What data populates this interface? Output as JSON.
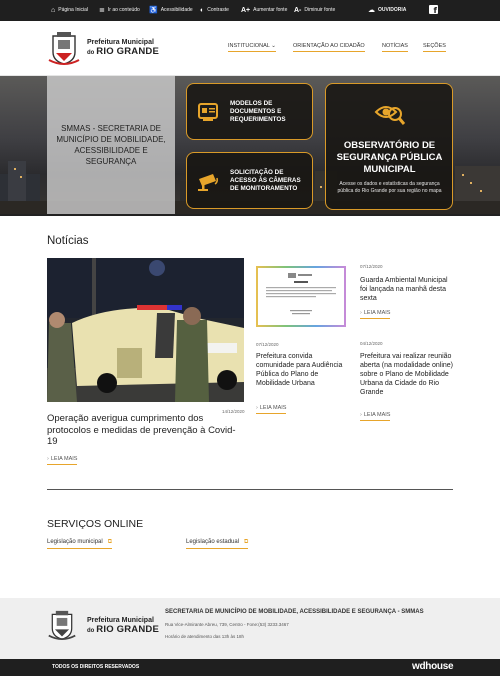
{
  "topbar": {
    "items": [
      {
        "icon": "home-icon",
        "label": "Página Inicial"
      },
      {
        "icon": "content-icon",
        "label": "Ir ao conteúdo"
      },
      {
        "icon": "accessibility-icon",
        "label": "Acessibilidade"
      },
      {
        "icon": "contrast-icon",
        "label": "Contraste"
      },
      {
        "icon": "font-increase-icon",
        "label": "Aumentar fonte"
      },
      {
        "icon": "font-decrease-icon",
        "label": "Diminuir fonte"
      }
    ],
    "ouvidoria": "OUVIDORIA",
    "facebook_glyph": "f"
  },
  "header": {
    "logo_line1": "Prefeitura Municipal",
    "logo_line2_small": "do",
    "logo_line2_big": "RIO GRANDE",
    "nav": [
      "INSTITUCIONAL ⌄",
      "ORIENTAÇÃO AO CIDADÃO",
      "NOTÍCIAS",
      "SEÇÕES"
    ]
  },
  "hero": {
    "secretaria": "SMMAS - SECRETARIA DE MUNICÍPIO DE MOBILIDADE, ACESSIBILIDADE E SEGURANÇA",
    "card1": "MODELOS DE DOCUMENTOS E REQUERIMENTOS",
    "card2": "SOLICITAÇÃO DE ACESSO ÀS CÂMERAS DE MONITORAMENTO",
    "obs_title": "OBSERVATÓRIO DE SEGURANÇA PÚBLICA MUNICIPAL",
    "obs_sub": "Acesse os dados e estatísticas da segurança pública do Rio Grande por sua região no mapa"
  },
  "news": {
    "section_title": "Notícias",
    "read_more": "LEIA MAIS",
    "main": {
      "date": "14/12/2020",
      "title": "Operação averigua cumprimento dos protocolos e medidas de prevenção à Covid-19"
    },
    "middle": {
      "date": "07/12/2020",
      "title": "Prefeitura convida comunidade para Audiência Pública do Plano de Mobilidade Urbana"
    },
    "right_top": {
      "date": "07/12/2020",
      "title": "Guarda Ambiental Municipal foi lançada na manhã desta sexta"
    },
    "right_bottom": {
      "date": "04/12/2020",
      "title": "Prefeitura vai realizar reunião aberta (na modalidade online) sobre o Plano de Mobilidade Urbana da Cidade do Rio Grande"
    }
  },
  "services": {
    "title": "SERVIÇOS ONLINE",
    "items": [
      "Legislação municipal",
      "Legislação estadual"
    ]
  },
  "footer": {
    "logo_line1": "Prefeitura Municipal",
    "logo_line2_small": "do",
    "logo_line2_big": "RIO GRANDE",
    "title": "SECRETARIA DE MUNICÍPIO DE MOBILIDADE, ACESSIBILIDADE E SEGURANÇA - SMMAS",
    "address": "Rua Vice-Almirante Abreu, 739, Centro - Fone:(53) 3233.3467",
    "hours": "Horário de atendimento das 13h às 18h",
    "rights": "TODOS OS DIREITOS RESERVADOS",
    "brand": "wdhouse"
  },
  "colors": {
    "accent": "#e7a52b",
    "dark": "#1f1f1f",
    "footer_bg": "#efefef"
  }
}
